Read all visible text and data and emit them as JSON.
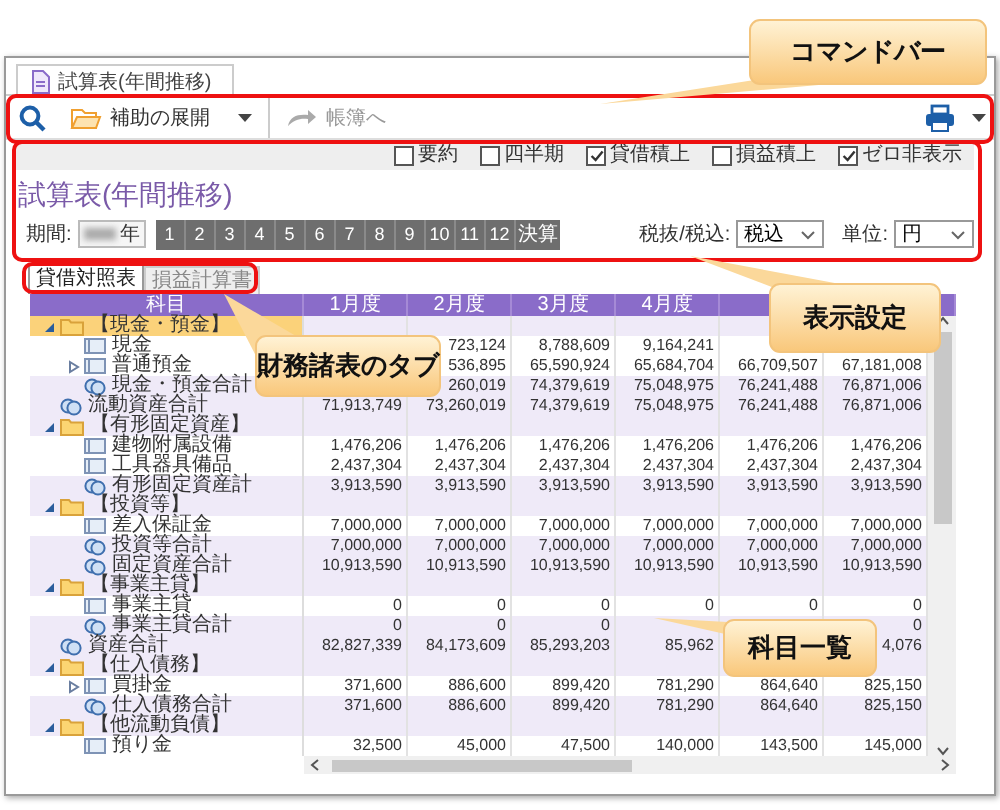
{
  "document_tab": {
    "title": "試算表(年間推移)"
  },
  "command_bar": {
    "expand_button": {
      "label": "補助の展開"
    },
    "ledger_button": {
      "label": "帳簿へ",
      "disabled": true
    }
  },
  "options": [
    {
      "label": "要約",
      "checked": false
    },
    {
      "label": "四半期",
      "checked": false
    },
    {
      "label": "貸借積上",
      "checked": true
    },
    {
      "label": "損益積上",
      "checked": false
    },
    {
      "label": "ゼロ非表示",
      "checked": true
    }
  ],
  "title": "試算表(年間推移)",
  "period": {
    "label": "期間:",
    "year_suffix": "年",
    "buttons": [
      "1",
      "2",
      "3",
      "4",
      "5",
      "6",
      "7",
      "8",
      "9",
      "10",
      "11",
      "12",
      "決算"
    ]
  },
  "tax_mode": {
    "label": "税抜/税込:",
    "value": "税込"
  },
  "unit": {
    "label": "単位:",
    "value": "円"
  },
  "sheet_tabs": [
    {
      "label": "貸借対照表",
      "selected": true
    },
    {
      "label": "損益計算書",
      "selected": false
    }
  ],
  "grid": {
    "columns": [
      "科目",
      "1月度",
      "2月度",
      "3月度",
      "4月度"
    ],
    "rows": [
      {
        "kind": "group",
        "name": "【現金・預金】",
        "expanded": true,
        "selected": true,
        "children": [
          {
            "kind": "account",
            "name": "現金",
            "selected": false,
            "values": {
              "month_2": "723,124",
              "month_3": "8,788,609",
              "month_4": "9,164,241"
            }
          },
          {
            "kind": "account",
            "name": "普通預金",
            "expanded": false,
            "selected": false,
            "values": {
              "month_2": "536,895",
              "month_3": "65,590,924",
              "month_4": "65,684,704",
              "month_5": "66,709,507",
              "month_6": "67,181,008"
            }
          },
          {
            "kind": "total",
            "name": "現金・預金合計",
            "selected": false,
            "values": {
              "month_2": "260,019",
              "month_3": "74,379,619",
              "month_4": "75,048,975",
              "month_5": "76,241,488",
              "month_6": "76,871,006"
            }
          }
        ]
      },
      {
        "kind": "total",
        "name": "流動資産合計",
        "selected": false,
        "values": {
          "month_1": "71,913,749",
          "month_2": "73,260,019",
          "month_3": "74,379,619",
          "month_4": "75,048,975",
          "month_5": "76,241,488",
          "month_6": "76,871,006"
        }
      },
      {
        "kind": "group",
        "name": "【有形固定資産】",
        "expanded": true,
        "selected": false,
        "children": [
          {
            "kind": "account",
            "name": "建物附属設備",
            "selected": false,
            "values": {
              "month_1": "1,476,206",
              "month_2": "1,476,206",
              "month_3": "1,476,206",
              "month_4": "1,476,206",
              "month_5": "1,476,206",
              "month_6": "1,476,206"
            }
          },
          {
            "kind": "account",
            "name": "工具器具備品",
            "selected": false,
            "values": {
              "month_1": "2,437,304",
              "month_2": "2,437,304",
              "month_3": "2,437,304",
              "month_4": "2,437,304",
              "month_5": "2,437,304",
              "month_6": "2,437,304"
            }
          },
          {
            "kind": "total",
            "name": "有形固定資産計",
            "selected": false,
            "values": {
              "month_1": "3,913,590",
              "month_2": "3,913,590",
              "month_3": "3,913,590",
              "month_4": "3,913,590",
              "month_5": "3,913,590",
              "month_6": "3,913,590"
            }
          }
        ]
      },
      {
        "kind": "group",
        "name": "【投資等】",
        "expanded": true,
        "selected": false,
        "children": [
          {
            "kind": "account",
            "name": "差入保証金",
            "selected": false,
            "values": {
              "month_1": "7,000,000",
              "month_2": "7,000,000",
              "month_3": "7,000,000",
              "month_4": "7,000,000",
              "month_5": "7,000,000",
              "month_6": "7,000,000"
            }
          },
          {
            "kind": "total",
            "name": "投資等合計",
            "selected": false,
            "values": {
              "month_1": "7,000,000",
              "month_2": "7,000,000",
              "month_3": "7,000,000",
              "month_4": "7,000,000",
              "month_5": "7,000,000",
              "month_6": "7,000,000"
            }
          },
          {
            "kind": "total",
            "name": "固定資産合計",
            "selected": false,
            "values": {
              "month_1": "10,913,590",
              "month_2": "10,913,590",
              "month_3": "10,913,590",
              "month_4": "10,913,590",
              "month_5": "10,913,590",
              "month_6": "10,913,590"
            }
          }
        ]
      },
      {
        "kind": "group",
        "name": "【事業主貸】",
        "expanded": true,
        "selected": false,
        "children": [
          {
            "kind": "account",
            "name": "事業主貸",
            "selected": false,
            "values": {
              "month_1": "0",
              "month_2": "0",
              "month_3": "0",
              "month_4": "0",
              "month_5": "0",
              "month_6": "0"
            }
          },
          {
            "kind": "total",
            "name": "事業主貸合計",
            "selected": false,
            "values": {
              "month_1": "0",
              "month_2": "0",
              "month_3": "0",
              "month_6": "0"
            }
          }
        ]
      },
      {
        "kind": "total",
        "name": "資産合計",
        "selected": false,
        "values": {
          "month_1": "82,827,339",
          "month_2": "84,173,609",
          "month_3": "85,293,203",
          "month_4": "85,962",
          "month_6": "4,076"
        }
      },
      {
        "kind": "group",
        "name": "【仕入債務】",
        "expanded": true,
        "selected": false,
        "children": [
          {
            "kind": "account",
            "name": "買掛金",
            "expanded": false,
            "selected": false,
            "values": {
              "month_1": "371,600",
              "month_2": "886,600",
              "month_3": "899,420",
              "month_4": "781,290",
              "month_5": "864,640",
              "month_6": "825,150"
            }
          },
          {
            "kind": "total",
            "name": "仕入債務合計",
            "selected": false,
            "values": {
              "month_1": "371,600",
              "month_2": "886,600",
              "month_3": "899,420",
              "month_4": "781,290",
              "month_5": "864,640",
              "month_6": "825,150"
            }
          }
        ]
      },
      {
        "kind": "group",
        "name": "【他流動負債】",
        "expanded": true,
        "selected": false,
        "children": [
          {
            "kind": "account",
            "name": "預り金",
            "selected": false,
            "values": {
              "month_1": "32,500",
              "month_2": "45,000",
              "month_3": "47,500",
              "month_4": "140,000",
              "month_5": "143,500",
              "month_6": "145,000"
            }
          }
        ]
      }
    ]
  },
  "callouts": [
    {
      "text": "コマンドバー"
    },
    {
      "text": "表示設定"
    },
    {
      "text": "財務諸表のタブ"
    },
    {
      "text": "科目一覧"
    }
  ]
}
